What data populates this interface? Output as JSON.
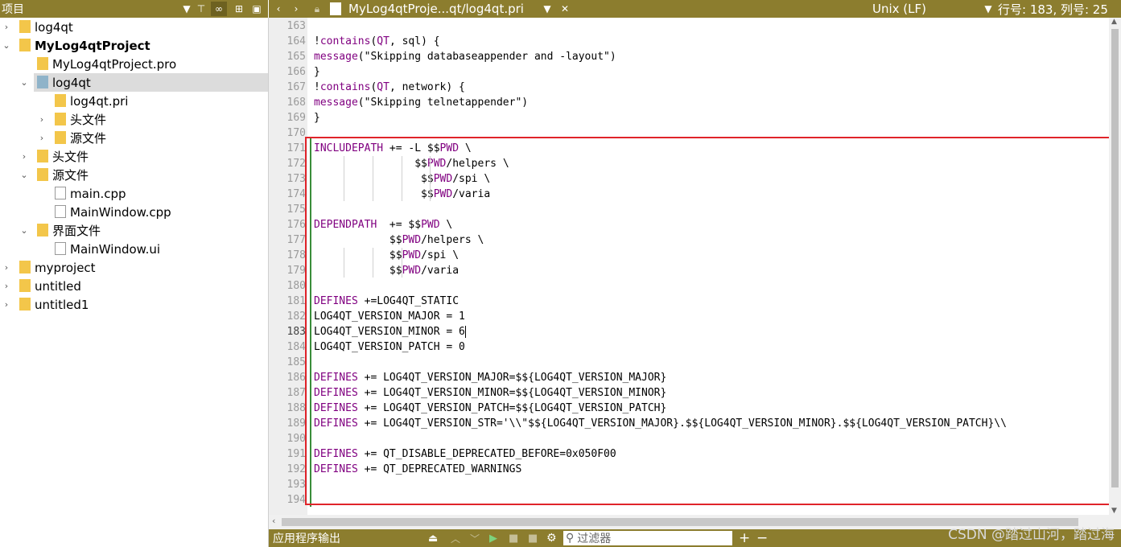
{
  "left_panel": {
    "title": "项目"
  },
  "tree": [
    {
      "label": "log4qt",
      "level": 0,
      "arrow": "›",
      "icon": "pro",
      "bold": false,
      "sel": false
    },
    {
      "label": "MyLog4qtProject",
      "level": 0,
      "arrow": "⌄",
      "icon": "proj",
      "bold": true,
      "sel": false
    },
    {
      "label": "MyLog4qtProject.pro",
      "level": 1,
      "arrow": "",
      "icon": "pro",
      "bold": false,
      "sel": false
    },
    {
      "label": "log4qt",
      "level": 1,
      "arrow": "⌄",
      "icon": "folder-pri",
      "bold": false,
      "sel": true
    },
    {
      "label": "log4qt.pri",
      "level": 2,
      "arrow": "",
      "icon": "pro",
      "bold": false,
      "sel": false
    },
    {
      "label": "头文件",
      "level": 2,
      "arrow": "›",
      "icon": "hfolder",
      "bold": false,
      "sel": false
    },
    {
      "label": "源文件",
      "level": 2,
      "arrow": "›",
      "icon": "cfolder",
      "bold": false,
      "sel": false
    },
    {
      "label": "头文件",
      "level": 1,
      "arrow": "›",
      "icon": "hfolder",
      "bold": false,
      "sel": false
    },
    {
      "label": "源文件",
      "level": 1,
      "arrow": "⌄",
      "icon": "cfolder",
      "bold": false,
      "sel": false
    },
    {
      "label": "main.cpp",
      "level": 2,
      "arrow": "",
      "icon": "cpp",
      "bold": false,
      "sel": false
    },
    {
      "label": "MainWindow.cpp",
      "level": 2,
      "arrow": "",
      "icon": "cpp",
      "bold": false,
      "sel": false
    },
    {
      "label": "界面文件",
      "level": 1,
      "arrow": "⌄",
      "icon": "uifolder",
      "bold": false,
      "sel": false
    },
    {
      "label": "MainWindow.ui",
      "level": 2,
      "arrow": "",
      "icon": "ui",
      "bold": false,
      "sel": false
    },
    {
      "label": "myproject",
      "level": 0,
      "arrow": "›",
      "icon": "proj",
      "bold": false,
      "sel": false
    },
    {
      "label": "untitled",
      "level": 0,
      "arrow": "›",
      "icon": "proj",
      "bold": false,
      "sel": false
    },
    {
      "label": "untitled1",
      "level": 0,
      "arrow": "›",
      "icon": "proj",
      "bold": false,
      "sel": false
    }
  ],
  "editor_toolbar": {
    "file_tab": "MyLog4qtProje...qt/log4qt.pri",
    "line_ending": "Unix (LF)",
    "position": "行号: 183, 列号: 25"
  },
  "code_lines": [
    {
      "n": "163",
      "t": []
    },
    {
      "n": "164",
      "t": [
        [
          "",
          "!"
        ],
        [
          "kw",
          "contains"
        ],
        [
          "",
          "("
        ],
        [
          "kw",
          "QT"
        ],
        [
          "",
          ", sql) {"
        ]
      ]
    },
    {
      "n": "165",
      "t": [
        [
          "kw",
          "message"
        ],
        [
          "",
          "(\"Skipping databaseappender and -layout\")"
        ]
      ]
    },
    {
      "n": "166",
      "t": [
        [
          "",
          "}"
        ]
      ]
    },
    {
      "n": "167",
      "t": [
        [
          "",
          "!"
        ],
        [
          "kw",
          "contains"
        ],
        [
          "",
          "("
        ],
        [
          "kw",
          "QT"
        ],
        [
          "",
          ", network) {"
        ]
      ]
    },
    {
      "n": "168",
      "t": [
        [
          "kw",
          "message"
        ],
        [
          "",
          "(\"Skipping telnetappender\")"
        ]
      ]
    },
    {
      "n": "169",
      "t": [
        [
          "",
          "}"
        ]
      ]
    },
    {
      "n": "170",
      "t": []
    },
    {
      "n": "171",
      "t": [
        [
          "kw",
          "INCLUDEPATH"
        ],
        [
          "",
          " += -L $$"
        ],
        [
          "kw",
          "PWD"
        ],
        [
          "",
          " \\"
        ]
      ]
    },
    {
      "n": "172",
      "t": [
        [
          "",
          "                $$"
        ],
        [
          "kw",
          "PWD"
        ],
        [
          "",
          "/helpers \\"
        ]
      ]
    },
    {
      "n": "173",
      "t": [
        [
          "",
          "                 $$"
        ],
        [
          "kw",
          "PWD"
        ],
        [
          "",
          "/spi \\"
        ]
      ]
    },
    {
      "n": "174",
      "t": [
        [
          "",
          "                 $$"
        ],
        [
          "kw",
          "PWD"
        ],
        [
          "",
          "/varia"
        ]
      ]
    },
    {
      "n": "175",
      "t": []
    },
    {
      "n": "176",
      "t": [
        [
          "kw",
          "DEPENDPATH"
        ],
        [
          "",
          "  += $$"
        ],
        [
          "kw",
          "PWD"
        ],
        [
          "",
          " \\"
        ]
      ]
    },
    {
      "n": "177",
      "t": [
        [
          "",
          "            $$"
        ],
        [
          "kw",
          "PWD"
        ],
        [
          "",
          "/helpers \\"
        ]
      ]
    },
    {
      "n": "178",
      "t": [
        [
          "",
          "            $$"
        ],
        [
          "kw",
          "PWD"
        ],
        [
          "",
          "/spi \\"
        ]
      ]
    },
    {
      "n": "179",
      "t": [
        [
          "",
          "            $$"
        ],
        [
          "kw",
          "PWD"
        ],
        [
          "",
          "/varia"
        ]
      ]
    },
    {
      "n": "180",
      "t": []
    },
    {
      "n": "181",
      "t": [
        [
          "kw",
          "DEFINES"
        ],
        [
          "",
          " +=LOG4QT_STATIC"
        ]
      ]
    },
    {
      "n": "182",
      "t": [
        [
          "",
          "LOG4QT_VERSION_MAJOR = 1"
        ]
      ]
    },
    {
      "n": "183",
      "t": [
        [
          "",
          "LOG4QT_VERSION_MINOR = 6"
        ]
      ]
    },
    {
      "n": "184",
      "t": [
        [
          "",
          "LOG4QT_VERSION_PATCH = 0"
        ]
      ]
    },
    {
      "n": "185",
      "t": []
    },
    {
      "n": "186",
      "t": [
        [
          "kw",
          "DEFINES"
        ],
        [
          "",
          " += LOG4QT_VERSION_MAJOR=$${LOG4QT_VERSION_MAJOR}"
        ]
      ]
    },
    {
      "n": "187",
      "t": [
        [
          "kw",
          "DEFINES"
        ],
        [
          "",
          " += LOG4QT_VERSION_MINOR=$${LOG4QT_VERSION_MINOR}"
        ]
      ]
    },
    {
      "n": "188",
      "t": [
        [
          "kw",
          "DEFINES"
        ],
        [
          "",
          " += LOG4QT_VERSION_PATCH=$${LOG4QT_VERSION_PATCH}"
        ]
      ]
    },
    {
      "n": "189",
      "t": [
        [
          "kw",
          "DEFINES"
        ],
        [
          "",
          " += LOG4QT_VERSION_STR='\\\\\"$${LOG4QT_VERSION_MAJOR}.$${LOG4QT_VERSION_MINOR}.$${LOG4QT_VERSION_PATCH}\\\\"
        ]
      ]
    },
    {
      "n": "190",
      "t": []
    },
    {
      "n": "191",
      "t": [
        [
          "kw",
          "DEFINES"
        ],
        [
          "",
          " += QT_DISABLE_DEPRECATED_BEFORE=0x050F00"
        ]
      ]
    },
    {
      "n": "192",
      "t": [
        [
          "kw",
          "DEFINES"
        ],
        [
          "",
          " += QT_DEPRECATED_WARNINGS"
        ]
      ]
    },
    {
      "n": "193",
      "t": []
    },
    {
      "n": "194",
      "t": []
    }
  ],
  "current_line": "183",
  "bottom_panel": {
    "title": "应用程序输出",
    "filter_placeholder": "过滤器"
  },
  "watermark": "CSDN @踏过山河，踏过海",
  "colors": {
    "toolbar": "#8c7d2e",
    "keyword": "#800080",
    "highlight_box": "#e0242a"
  }
}
